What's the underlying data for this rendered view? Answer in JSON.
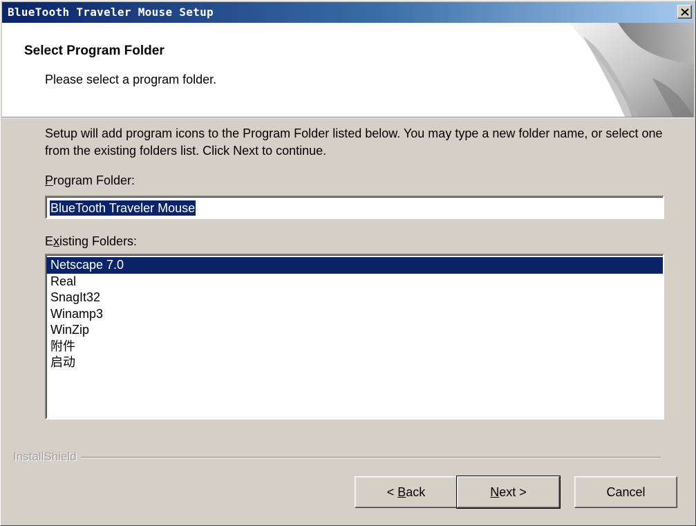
{
  "window": {
    "title": "BlueTooth Traveler Mouse Setup",
    "close_icon": "close-icon"
  },
  "header": {
    "title": "Select Program Folder",
    "subtitle": "Please select a program folder."
  },
  "body": {
    "instructions": "Setup will add program icons to the Program Folder listed below.  You may type a new folder name, or select one from the existing folders list.  Click Next to continue."
  },
  "program_folder": {
    "label_prefix": "",
    "label_accel": "P",
    "label_rest": "rogram Folder:",
    "value": "BlueTooth Traveler Mouse"
  },
  "existing_folders": {
    "label_prefix": "E",
    "label_accel": "x",
    "label_rest": "isting Folders:",
    "items": [
      "Netscape 7.0",
      "Real",
      "SnagIt32",
      "Winamp3",
      "WinZip",
      "附件",
      "启动"
    ],
    "selected": "Netscape 7.0"
  },
  "branding": {
    "text": "InstallShield"
  },
  "buttons": {
    "back": {
      "prefix": "< ",
      "accel": "B",
      "rest": "ack"
    },
    "next": {
      "prefix": "",
      "accel": "N",
      "rest": "ext >"
    },
    "cancel": "Cancel"
  },
  "colors": {
    "selection": "#0a246a",
    "title_gradient_start": "#0a246a",
    "title_gradient_end": "#a6caf0",
    "dialog_bg": "#d4d0c8"
  }
}
